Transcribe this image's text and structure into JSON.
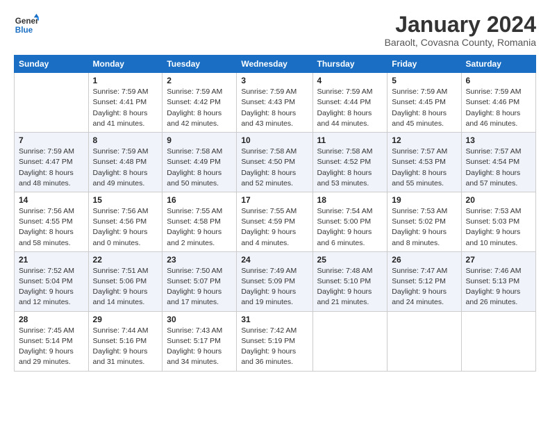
{
  "logo": {
    "line1": "General",
    "line2": "Blue"
  },
  "title": "January 2024",
  "subtitle": "Baraolt, Covasna County, Romania",
  "weekdays": [
    "Sunday",
    "Monday",
    "Tuesday",
    "Wednesday",
    "Thursday",
    "Friday",
    "Saturday"
  ],
  "weeks": [
    [
      {
        "day": "",
        "info": ""
      },
      {
        "day": "1",
        "info": "Sunrise: 7:59 AM\nSunset: 4:41 PM\nDaylight: 8 hours\nand 41 minutes."
      },
      {
        "day": "2",
        "info": "Sunrise: 7:59 AM\nSunset: 4:42 PM\nDaylight: 8 hours\nand 42 minutes."
      },
      {
        "day": "3",
        "info": "Sunrise: 7:59 AM\nSunset: 4:43 PM\nDaylight: 8 hours\nand 43 minutes."
      },
      {
        "day": "4",
        "info": "Sunrise: 7:59 AM\nSunset: 4:44 PM\nDaylight: 8 hours\nand 44 minutes."
      },
      {
        "day": "5",
        "info": "Sunrise: 7:59 AM\nSunset: 4:45 PM\nDaylight: 8 hours\nand 45 minutes."
      },
      {
        "day": "6",
        "info": "Sunrise: 7:59 AM\nSunset: 4:46 PM\nDaylight: 8 hours\nand 46 minutes."
      }
    ],
    [
      {
        "day": "7",
        "info": "Sunrise: 7:59 AM\nSunset: 4:47 PM\nDaylight: 8 hours\nand 48 minutes."
      },
      {
        "day": "8",
        "info": "Sunrise: 7:59 AM\nSunset: 4:48 PM\nDaylight: 8 hours\nand 49 minutes."
      },
      {
        "day": "9",
        "info": "Sunrise: 7:58 AM\nSunset: 4:49 PM\nDaylight: 8 hours\nand 50 minutes."
      },
      {
        "day": "10",
        "info": "Sunrise: 7:58 AM\nSunset: 4:50 PM\nDaylight: 8 hours\nand 52 minutes."
      },
      {
        "day": "11",
        "info": "Sunrise: 7:58 AM\nSunset: 4:52 PM\nDaylight: 8 hours\nand 53 minutes."
      },
      {
        "day": "12",
        "info": "Sunrise: 7:57 AM\nSunset: 4:53 PM\nDaylight: 8 hours\nand 55 minutes."
      },
      {
        "day": "13",
        "info": "Sunrise: 7:57 AM\nSunset: 4:54 PM\nDaylight: 8 hours\nand 57 minutes."
      }
    ],
    [
      {
        "day": "14",
        "info": "Sunrise: 7:56 AM\nSunset: 4:55 PM\nDaylight: 8 hours\nand 58 minutes."
      },
      {
        "day": "15",
        "info": "Sunrise: 7:56 AM\nSunset: 4:56 PM\nDaylight: 9 hours\nand 0 minutes."
      },
      {
        "day": "16",
        "info": "Sunrise: 7:55 AM\nSunset: 4:58 PM\nDaylight: 9 hours\nand 2 minutes."
      },
      {
        "day": "17",
        "info": "Sunrise: 7:55 AM\nSunset: 4:59 PM\nDaylight: 9 hours\nand 4 minutes."
      },
      {
        "day": "18",
        "info": "Sunrise: 7:54 AM\nSunset: 5:00 PM\nDaylight: 9 hours\nand 6 minutes."
      },
      {
        "day": "19",
        "info": "Sunrise: 7:53 AM\nSunset: 5:02 PM\nDaylight: 9 hours\nand 8 minutes."
      },
      {
        "day": "20",
        "info": "Sunrise: 7:53 AM\nSunset: 5:03 PM\nDaylight: 9 hours\nand 10 minutes."
      }
    ],
    [
      {
        "day": "21",
        "info": "Sunrise: 7:52 AM\nSunset: 5:04 PM\nDaylight: 9 hours\nand 12 minutes."
      },
      {
        "day": "22",
        "info": "Sunrise: 7:51 AM\nSunset: 5:06 PM\nDaylight: 9 hours\nand 14 minutes."
      },
      {
        "day": "23",
        "info": "Sunrise: 7:50 AM\nSunset: 5:07 PM\nDaylight: 9 hours\nand 17 minutes."
      },
      {
        "day": "24",
        "info": "Sunrise: 7:49 AM\nSunset: 5:09 PM\nDaylight: 9 hours\nand 19 minutes."
      },
      {
        "day": "25",
        "info": "Sunrise: 7:48 AM\nSunset: 5:10 PM\nDaylight: 9 hours\nand 21 minutes."
      },
      {
        "day": "26",
        "info": "Sunrise: 7:47 AM\nSunset: 5:12 PM\nDaylight: 9 hours\nand 24 minutes."
      },
      {
        "day": "27",
        "info": "Sunrise: 7:46 AM\nSunset: 5:13 PM\nDaylight: 9 hours\nand 26 minutes."
      }
    ],
    [
      {
        "day": "28",
        "info": "Sunrise: 7:45 AM\nSunset: 5:14 PM\nDaylight: 9 hours\nand 29 minutes."
      },
      {
        "day": "29",
        "info": "Sunrise: 7:44 AM\nSunset: 5:16 PM\nDaylight: 9 hours\nand 31 minutes."
      },
      {
        "day": "30",
        "info": "Sunrise: 7:43 AM\nSunset: 5:17 PM\nDaylight: 9 hours\nand 34 minutes."
      },
      {
        "day": "31",
        "info": "Sunrise: 7:42 AM\nSunset: 5:19 PM\nDaylight: 9 hours\nand 36 minutes."
      },
      {
        "day": "",
        "info": ""
      },
      {
        "day": "",
        "info": ""
      },
      {
        "day": "",
        "info": ""
      }
    ]
  ]
}
